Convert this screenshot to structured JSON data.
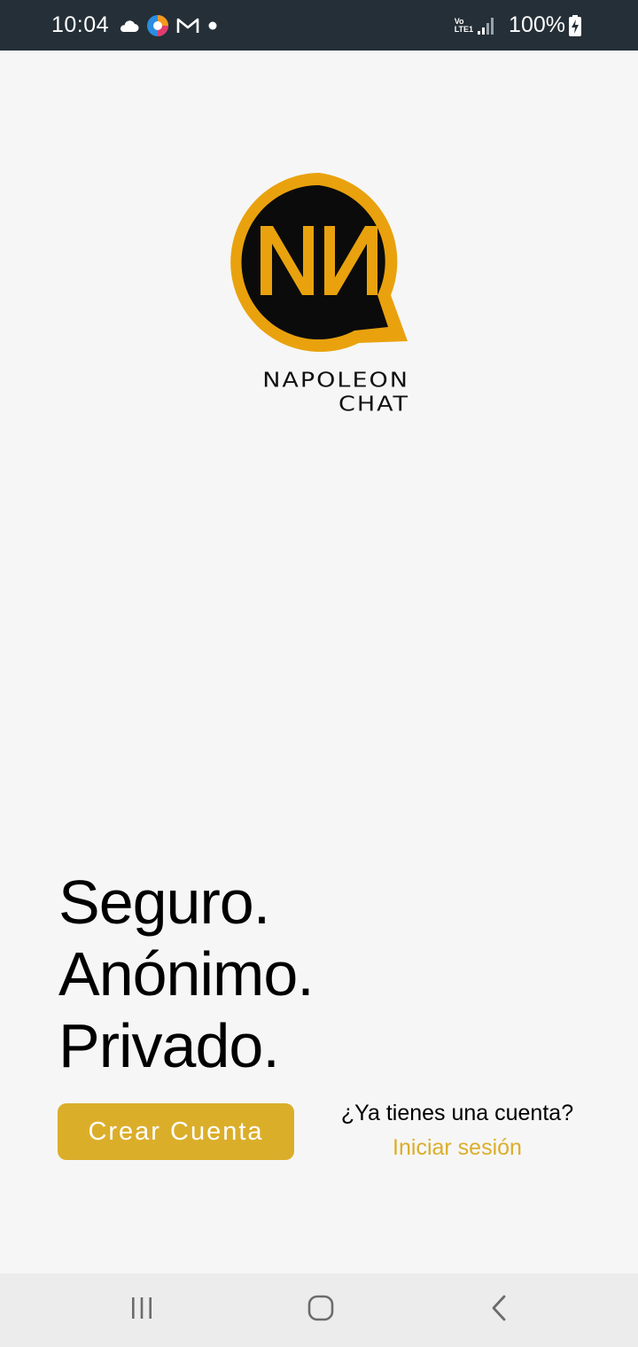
{
  "status_bar": {
    "time": "10:04",
    "network_top": "Vo",
    "network_bottom": "LTE1",
    "battery": "100%",
    "icons": [
      "cloud-icon",
      "edge-browser-icon",
      "gmail-icon",
      "notification-dot-icon",
      "signal-icon",
      "battery-charging-icon"
    ]
  },
  "logo": {
    "line1": "NAPOLEON",
    "line2": "CHAT",
    "colors": {
      "ring": "#e9a20d",
      "inner": "#0b0b0b"
    }
  },
  "tagline": {
    "line1": "Seguro.",
    "line2": "Anónimo.",
    "line3": "Privado."
  },
  "actions": {
    "create_account_label": "Crear Cuenta",
    "login_question": "¿Ya tienes una cuenta?",
    "login_link": "Iniciar sesión"
  },
  "colors": {
    "accent": "#dbae2a",
    "status_bar": "#252f37",
    "background": "#f6f6f6"
  },
  "nav_bar": {
    "icons": [
      "recents-icon",
      "home-icon",
      "back-icon"
    ]
  }
}
